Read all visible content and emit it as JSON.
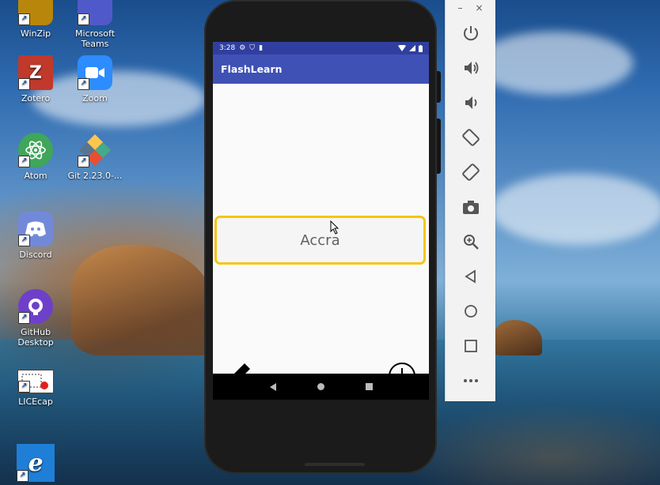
{
  "desktop": {
    "icons": [
      {
        "label": "WinZip"
      },
      {
        "label": "Microsoft Teams"
      },
      {
        "label": "Zotero"
      },
      {
        "label": "Zoom"
      },
      {
        "label": "Atom"
      },
      {
        "label": "Git 2.23.0-..."
      },
      {
        "label": "Discord"
      },
      {
        "label": "GitHub Desktop"
      },
      {
        "label": "LICEcap"
      }
    ]
  },
  "phone": {
    "status": {
      "time": "3:28"
    },
    "app_title": "FlashLearn",
    "card_text": "Accra"
  },
  "emulator_toolbar": {
    "minimize_label": "–",
    "close_label": "×",
    "buttons": [
      "power-icon",
      "volume-up-icon",
      "volume-down-icon",
      "rotate-left-icon",
      "rotate-right-icon",
      "camera-icon",
      "zoom-icon",
      "back-icon",
      "home-icon",
      "overview-icon",
      "more-icon"
    ]
  }
}
